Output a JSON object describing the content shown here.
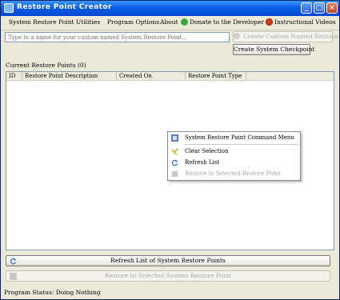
{
  "window": {
    "title": "Restore Point Creator"
  },
  "menubar": {
    "items": [
      "System Restore Point Utilities",
      "Program Options",
      "About",
      "Donate to the Developer",
      "Instructional Videos"
    ]
  },
  "name_input": {
    "placeholder": "Type in a name for your custom-named System Restore Point..."
  },
  "buttons": {
    "create_named": "Create Custom Named Restore",
    "create_checkpoint": "Create System Checkpoint",
    "refresh_list": "Refresh List of System Restore Points",
    "restore_selected": "Restore to Selected System Restore Point"
  },
  "list": {
    "label": "Current Restore Points (0)",
    "columns": [
      "ID",
      "Restore Point Description",
      "Created On",
      "Restore Point Type"
    ],
    "rows": []
  },
  "context_menu": {
    "items": [
      {
        "label": "System Restore Point Command Menu",
        "icon": "command-menu-icon",
        "enabled": true
      },
      {
        "label": "Clear Selection",
        "icon": "broom-icon",
        "enabled": true
      },
      {
        "label": "Refresh List",
        "icon": "refresh-icon",
        "enabled": true
      },
      {
        "label": "Restore to Selected Restore Point",
        "icon": "restore-icon",
        "enabled": false
      }
    ]
  },
  "status": {
    "text": "Program Status: Doing Nothing"
  },
  "colors": {
    "titlebar": "#0a5ee6",
    "window_bg": "#ece9d8",
    "list_border": "#7f9db9"
  }
}
